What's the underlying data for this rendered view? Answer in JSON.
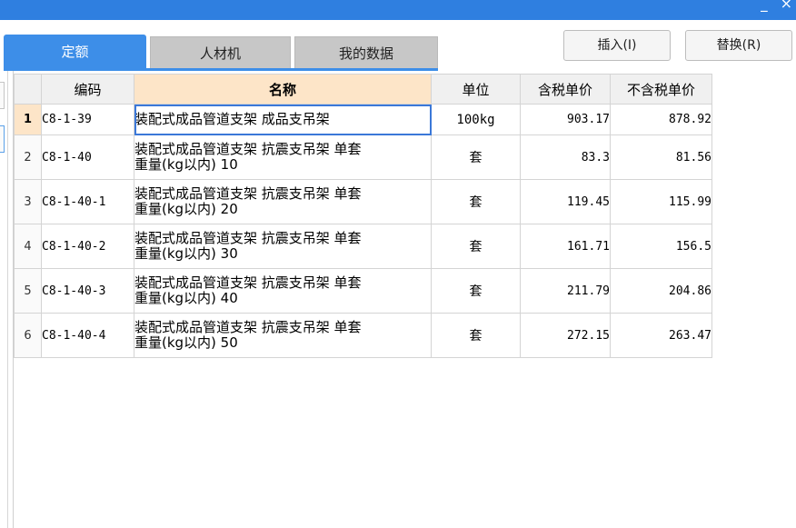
{
  "window": {
    "controls": [
      "_",
      "×"
    ]
  },
  "tabs": [
    {
      "label": "定额",
      "active": true
    },
    {
      "label": "人材机",
      "active": false
    },
    {
      "label": "我的数据",
      "active": false
    }
  ],
  "buttons": {
    "insert": "插入(I)",
    "replace": "替换(R)"
  },
  "table": {
    "columns": [
      "编码",
      "名称",
      "单位",
      "含税单价",
      "不含税单价"
    ],
    "rows": [
      {
        "index": "1",
        "code": "C8-1-39",
        "name_l1": "装配式成品管道支架 成品支吊架",
        "name_l2": "",
        "unit": "100kg",
        "price_tax": "903.17",
        "price_notax": "878.92"
      },
      {
        "index": "2",
        "code": "C8-1-40",
        "name_l1": "装配式成品管道支架 抗震支吊架 单套",
        "name_l2": "重量(kg以内) 10",
        "unit": "套",
        "price_tax": "83.3",
        "price_notax": "81.56"
      },
      {
        "index": "3",
        "code": "C8-1-40-1",
        "name_l1": "装配式成品管道支架 抗震支吊架 单套",
        "name_l2": "重量(kg以内) 20",
        "unit": "套",
        "price_tax": "119.45",
        "price_notax": "115.99"
      },
      {
        "index": "4",
        "code": "C8-1-40-2",
        "name_l1": "装配式成品管道支架 抗震支吊架 单套",
        "name_l2": "重量(kg以内) 30",
        "unit": "套",
        "price_tax": "161.71",
        "price_notax": "156.5"
      },
      {
        "index": "5",
        "code": "C8-1-40-3",
        "name_l1": "装配式成品管道支架 抗震支吊架 单套",
        "name_l2": "重量(kg以内) 40",
        "unit": "套",
        "price_tax": "211.79",
        "price_notax": "204.86"
      },
      {
        "index": "6",
        "code": "C8-1-40-4",
        "name_l1": "装配式成品管道支架 抗震支吊架 单套",
        "name_l2": "重量(kg以内) 50",
        "unit": "套",
        "price_tax": "272.15",
        "price_notax": "263.47"
      }
    ]
  }
}
